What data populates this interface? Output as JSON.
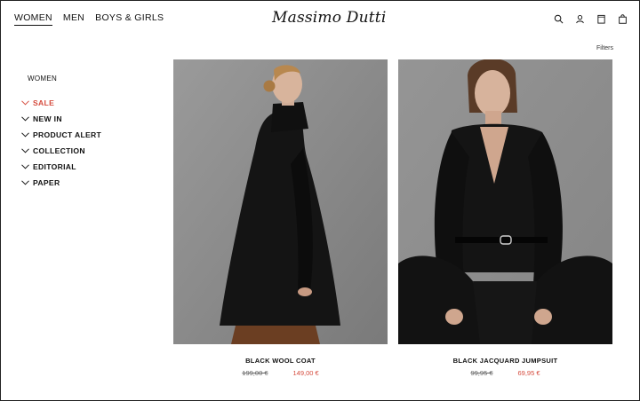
{
  "nav": {
    "items": [
      {
        "label": "WOMEN",
        "active": true
      },
      {
        "label": "MEN",
        "active": false
      },
      {
        "label": "BOYS & GIRLS",
        "active": false
      }
    ]
  },
  "brand": "Massimo Dutti",
  "header_icons": [
    "search-icon",
    "user-icon",
    "wishlist-icon",
    "bag-icon"
  ],
  "filters_label": "Filters",
  "sidebar": {
    "title": "WOMEN",
    "items": [
      {
        "label": "SALE",
        "highlight": true
      },
      {
        "label": "NEW IN"
      },
      {
        "label": "PRODUCT ALERT"
      },
      {
        "label": "COLLECTION"
      },
      {
        "label": "EDITORIAL"
      },
      {
        "label": "PAPER"
      }
    ]
  },
  "products": [
    {
      "name": "BLACK WOOL COAT",
      "old_price": "199,00 €",
      "new_price": "149,00 €"
    },
    {
      "name": "BLACK JACQUARD JUMPSUIT",
      "old_price": "99,95 €",
      "new_price": "69,95 €"
    }
  ],
  "colors": {
    "sale": "#d54b3d",
    "text": "#111111",
    "photo_bg": "#8b8b8b"
  }
}
